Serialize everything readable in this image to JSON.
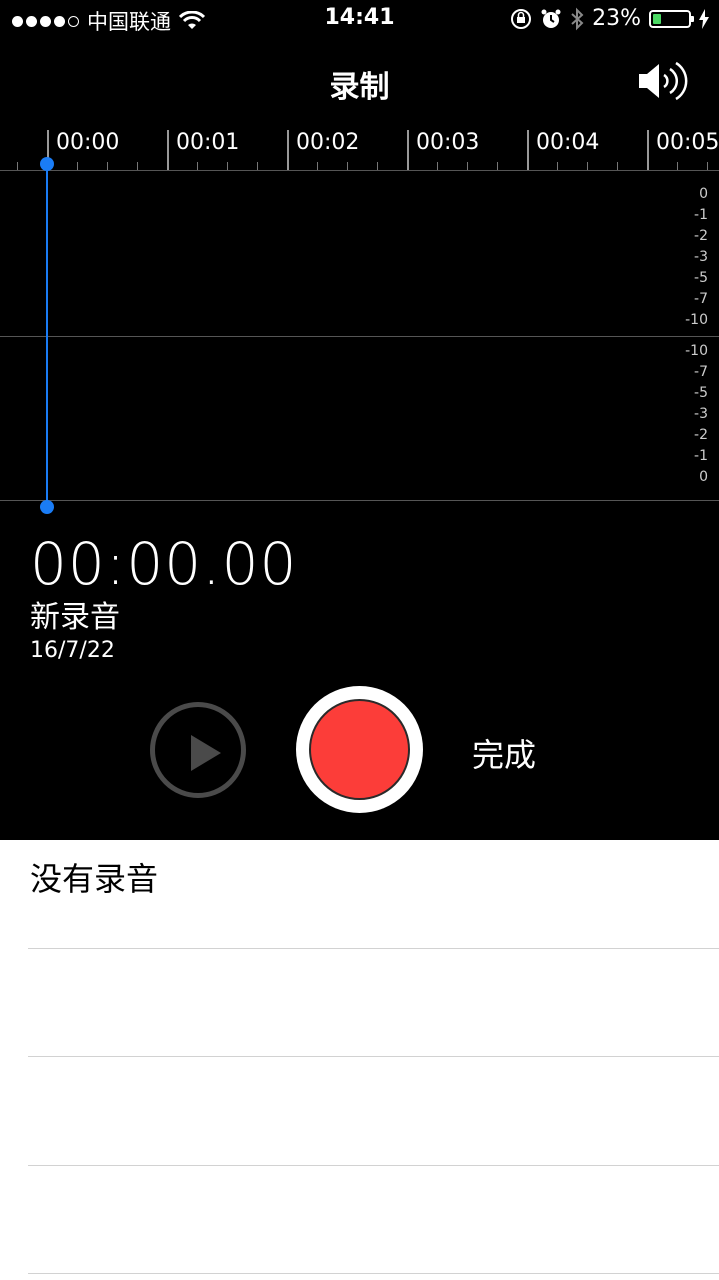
{
  "status_bar": {
    "carrier": "中国联通",
    "time": "14:41",
    "battery_percent": "23%",
    "battery_level": 0.23,
    "battery_color": "#4cd964",
    "signal_bars": 4,
    "icons": [
      "wifi-icon",
      "orientation-lock-icon",
      "alarm-icon",
      "bluetooth-icon",
      "battery-icon",
      "charging-icon"
    ]
  },
  "header": {
    "title": "录制",
    "speaker_icon": "speaker-icon"
  },
  "timeline": {
    "ticks": [
      "00:00",
      "00:01",
      "00:02",
      "00:03",
      "00:04",
      "00:05"
    ]
  },
  "meter": {
    "top_scale": [
      "0",
      "-1",
      "-2",
      "-3",
      "-5",
      "-7",
      "-10"
    ],
    "bottom_scale": [
      "-10",
      "-7",
      "-5",
      "-3",
      "-2",
      "-1",
      "0"
    ],
    "accent": "#1a7cf5"
  },
  "recording": {
    "elapsed": "00:00.00",
    "name": "新录音",
    "date": "16/7/22"
  },
  "controls": {
    "done_label": "完成",
    "record_color": "#fc3d39"
  },
  "list": {
    "empty_label": "没有录音"
  }
}
